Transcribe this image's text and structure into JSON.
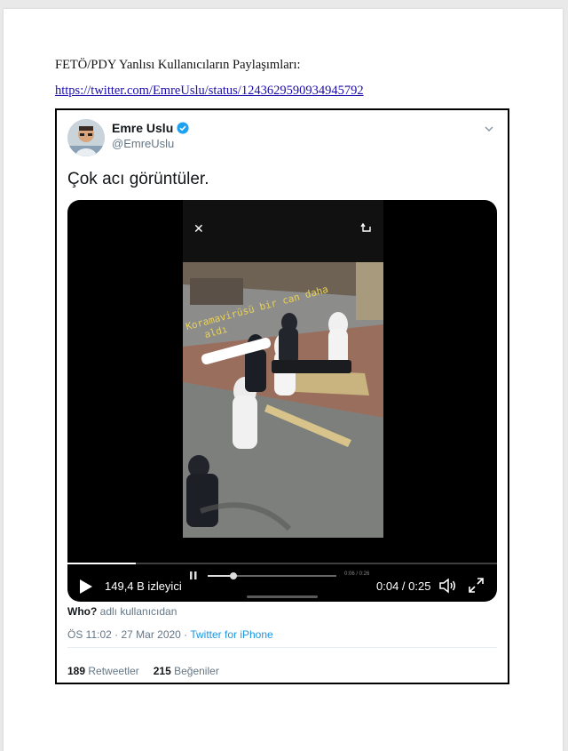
{
  "document": {
    "heading": "FETÖ/PDY Yanlısı Kullanıcıların Paylaşımları:",
    "link": "https://twitter.com/EmreUslu/status/1243629590934945792"
  },
  "tweet": {
    "display_name": "Emre Uslu",
    "handle": "@EmreUslu",
    "text": "Çok acı görüntüler.",
    "video": {
      "views": "149,4 B izleyici",
      "time": "0:04 / 0:25",
      "mini_time": "0:06 / 0:26",
      "progress": 0.16,
      "mini_progress": 0.2
    },
    "who_bold": "Who?",
    "who_rest": " adlı kullanıcıdan",
    "timestamp": "ÖS 11:02 · 27 Mar 2020 · ",
    "source": "Twitter for iPhone",
    "retweets_count": "189",
    "retweets_label": "Retweetler",
    "likes_count": "215",
    "likes_label": "Beğeniler"
  },
  "colors": {
    "link": "#1a0dab",
    "twitter_blue": "#1b95e0",
    "verified": "#1da1f2"
  }
}
